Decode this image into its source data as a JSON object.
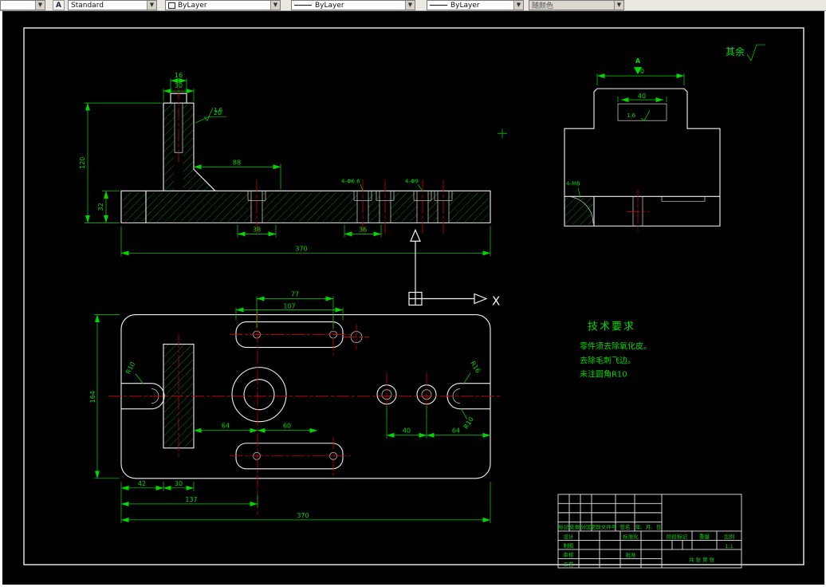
{
  "toolbar": {
    "partial_combo": {
      "value": ""
    },
    "text_style": {
      "icon": "A",
      "value": "Standard"
    },
    "color": {
      "value": "ByLayer"
    },
    "linetype": {
      "value": "ByLayer"
    },
    "lineweight": {
      "value": "ByLayer"
    },
    "plot_style": {
      "value": "随颜色"
    },
    "arrow_glyph": "▼"
  },
  "drawing": {
    "surface_note": "其余",
    "view_label": "A",
    "ucs": {
      "x_label": "X"
    },
    "tech_req": {
      "title": "技术要求",
      "line1": "零件须去除氧化皮。",
      "line2": "去除毛刺飞边。",
      "line3": "未注圆角R10"
    },
    "front_dims": {
      "total_width": "370",
      "height": "120",
      "base_height": "32",
      "col_width": "30",
      "col_top": "16",
      "step": "88",
      "span1": "38",
      "span2": "36",
      "boss": "20",
      "hole_note1": "4-Φ6.6",
      "hole_note2": "4-Φ9",
      "rough": "1.6"
    },
    "side_dims": {
      "top_width": "70",
      "slot_width": "40",
      "rough": "1.6",
      "hole_note": "4-M8"
    },
    "plan_dims": {
      "hole_pitch": "77",
      "plate_width": "107",
      "height": "164",
      "inner1": "64",
      "inner2": "60",
      "pitch_small": "40",
      "edge": "64",
      "b1": "42",
      "b2": "30",
      "b3": "137",
      "total": "370",
      "r_left": "R10",
      "r_right1": "R16",
      "r_right2": "R10"
    },
    "title_block": {
      "rev_header": [
        "标记",
        "处数",
        "分区",
        "更改文件号",
        "签名",
        "年、月、日"
      ],
      "design": "设计",
      "draft": "制图",
      "check": "审核",
      "process": "工艺",
      "standardization": "标准化",
      "approve": "批准",
      "stage_mark": "阶段标记",
      "weight": "重量",
      "scale": "比例",
      "scale_value": "1:1",
      "sheet_info": "共 张 第 张"
    }
  },
  "colors": {
    "dimension_green": "#00d900",
    "geometry_white": "#f2f2f2",
    "centerline_red": "#d40000",
    "canvas_black": "#000000"
  }
}
